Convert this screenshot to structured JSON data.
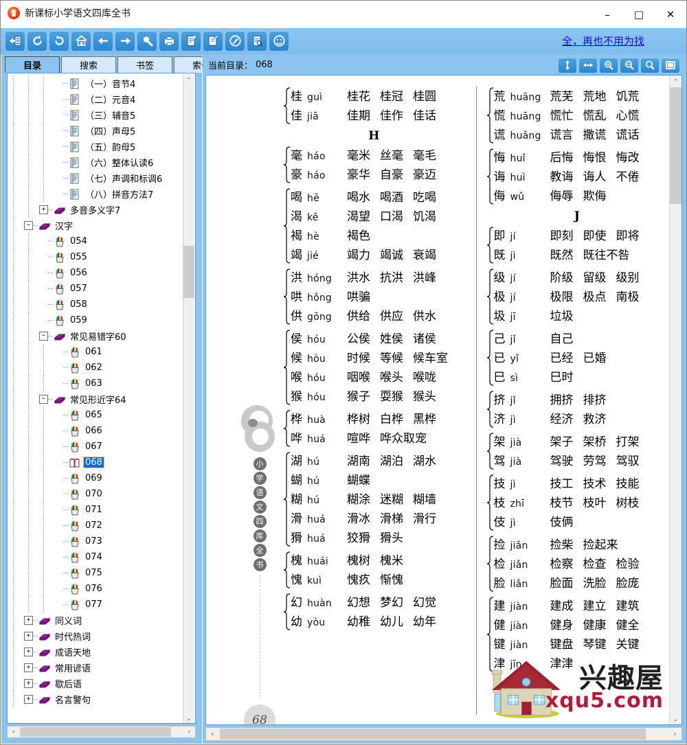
{
  "window": {
    "title": "新课标小学语文四库全书",
    "app_icon": "book-app-icon",
    "minimize": "–",
    "maximize": "□",
    "close": "✕"
  },
  "toolbar": {
    "icons": [
      {
        "name": "contents-pane-icon",
        "title": "目录"
      },
      {
        "name": "refresh-icon",
        "title": "刷新"
      },
      {
        "name": "undo-icon",
        "title": "后退"
      },
      {
        "name": "home-icon",
        "title": "主页"
      },
      {
        "name": "arrow-left-icon",
        "title": "上一页"
      },
      {
        "name": "arrow-right-icon",
        "title": "下一页"
      },
      {
        "name": "search-icon",
        "title": "查找"
      },
      {
        "name": "printer-icon",
        "title": "打印"
      },
      {
        "name": "new-note-icon",
        "title": "新建"
      },
      {
        "name": "edit-note-icon",
        "title": "编辑"
      },
      {
        "name": "pen-circle-icon",
        "title": "标注"
      },
      {
        "name": "document-search-icon",
        "title": "文档查找"
      },
      {
        "name": "smiley-icon",
        "title": "关于"
      }
    ],
    "promo_text": "全，再也不用为找"
  },
  "sidebar": {
    "tabs": [
      {
        "label": "目录",
        "active": true
      },
      {
        "label": "搜索",
        "active": false
      },
      {
        "label": "书签",
        "active": false
      },
      {
        "label": "索引",
        "active": false
      }
    ],
    "tree": [
      {
        "label": "（一）音节4",
        "icon": "page-icon",
        "depth": 4,
        "expander": "",
        "selected": false
      },
      {
        "label": "（二）元音4",
        "icon": "page-icon",
        "depth": 4,
        "expander": "",
        "selected": false
      },
      {
        "label": "（三）辅音5",
        "icon": "page-icon",
        "depth": 4,
        "expander": "",
        "selected": false
      },
      {
        "label": "（四）声母5",
        "icon": "page-icon",
        "depth": 4,
        "expander": "",
        "selected": false
      },
      {
        "label": "（五）韵母5",
        "icon": "page-icon",
        "depth": 4,
        "expander": "",
        "selected": false
      },
      {
        "label": "（六）整体认读6",
        "icon": "page-icon",
        "depth": 4,
        "expander": "",
        "selected": false
      },
      {
        "label": "（七）声调和标调6",
        "icon": "page-icon",
        "depth": 4,
        "expander": "",
        "selected": false
      },
      {
        "label": "（八）拼音方法7",
        "icon": "page-icon",
        "depth": 4,
        "expander": "",
        "selected": false
      },
      {
        "label": "多音多义字7",
        "icon": "book-icon",
        "depth": 3,
        "expander": "+",
        "selected": false
      },
      {
        "label": "汉字",
        "icon": "book-icon",
        "depth": 2,
        "expander": "−",
        "selected": false
      },
      {
        "label": "054",
        "icon": "pencilcup-icon",
        "depth": 3,
        "expander": "",
        "selected": false
      },
      {
        "label": "055",
        "icon": "pencilcup-icon",
        "depth": 3,
        "expander": "",
        "selected": false
      },
      {
        "label": "056",
        "icon": "pencilcup-icon",
        "depth": 3,
        "expander": "",
        "selected": false
      },
      {
        "label": "057",
        "icon": "pencilcup-icon",
        "depth": 3,
        "expander": "",
        "selected": false
      },
      {
        "label": "058",
        "icon": "pencilcup-icon",
        "depth": 3,
        "expander": "",
        "selected": false
      },
      {
        "label": "059",
        "icon": "pencilcup-icon",
        "depth": 3,
        "expander": "",
        "selected": false
      },
      {
        "label": "常见易错字60",
        "icon": "book-icon",
        "depth": 3,
        "expander": "−",
        "selected": false
      },
      {
        "label": "061",
        "icon": "pencilcup-icon",
        "depth": 4,
        "expander": "",
        "selected": false
      },
      {
        "label": "062",
        "icon": "pencilcup-icon",
        "depth": 4,
        "expander": "",
        "selected": false
      },
      {
        "label": "063",
        "icon": "pencilcup-icon",
        "depth": 4,
        "expander": "",
        "selected": false
      },
      {
        "label": "常见形近字64",
        "icon": "book-icon",
        "depth": 3,
        "expander": "−",
        "selected": false
      },
      {
        "label": "065",
        "icon": "pencilcup-icon",
        "depth": 4,
        "expander": "",
        "selected": false
      },
      {
        "label": "066",
        "icon": "pencilcup-icon",
        "depth": 4,
        "expander": "",
        "selected": false
      },
      {
        "label": "067",
        "icon": "pencilcup-icon",
        "depth": 4,
        "expander": "",
        "selected": false
      },
      {
        "label": "068",
        "icon": "openbook-icon",
        "depth": 4,
        "expander": "",
        "selected": true
      },
      {
        "label": "069",
        "icon": "pencilcup-icon",
        "depth": 4,
        "expander": "",
        "selected": false
      },
      {
        "label": "070",
        "icon": "pencilcup-icon",
        "depth": 4,
        "expander": "",
        "selected": false
      },
      {
        "label": "071",
        "icon": "pencilcup-icon",
        "depth": 4,
        "expander": "",
        "selected": false
      },
      {
        "label": "072",
        "icon": "pencilcup-icon",
        "depth": 4,
        "expander": "",
        "selected": false
      },
      {
        "label": "073",
        "icon": "pencilcup-icon",
        "depth": 4,
        "expander": "",
        "selected": false
      },
      {
        "label": "074",
        "icon": "pencilcup-icon",
        "depth": 4,
        "expander": "",
        "selected": false
      },
      {
        "label": "075",
        "icon": "pencilcup-icon",
        "depth": 4,
        "expander": "",
        "selected": false
      },
      {
        "label": "076",
        "icon": "pencilcup-icon",
        "depth": 4,
        "expander": "",
        "selected": false
      },
      {
        "label": "077",
        "icon": "pencilcup-icon",
        "depth": 4,
        "expander": "",
        "selected": false
      },
      {
        "label": "同义词",
        "icon": "book-icon",
        "depth": 2,
        "expander": "+",
        "selected": false
      },
      {
        "label": "时代热词",
        "icon": "book-icon",
        "depth": 2,
        "expander": "+",
        "selected": false
      },
      {
        "label": "成语天地",
        "icon": "book-icon",
        "depth": 2,
        "expander": "+",
        "selected": false
      },
      {
        "label": "常用谚语",
        "icon": "book-icon",
        "depth": 2,
        "expander": "+",
        "selected": false
      },
      {
        "label": "歇后语",
        "icon": "book-icon",
        "depth": 2,
        "expander": "+",
        "selected": false
      },
      {
        "label": "名言警句",
        "icon": "book-icon",
        "depth": 2,
        "expander": "+",
        "selected": false
      }
    ],
    "hscroll": {
      "left_arrow": "‹",
      "right_arrow": "›"
    },
    "vscroll": {
      "up_arrow": "⌃",
      "down_arrow": "⌄"
    }
  },
  "viewer": {
    "current_dir_label": "当前目录：",
    "current_dir_value": "068",
    "tools": [
      {
        "name": "fit-height-icon",
        "glyph": "↕"
      },
      {
        "name": "fit-width-icon",
        "glyph": "↔"
      },
      {
        "name": "zoom-in-icon",
        "glyph": "+"
      },
      {
        "name": "zoom-out-icon",
        "glyph": "−"
      },
      {
        "name": "zoom-reset-icon",
        "glyph": ""
      },
      {
        "name": "fullscreen-icon",
        "glyph": "▢"
      }
    ],
    "hscroll": {
      "left_arrow": "‹",
      "right_arrow": "›"
    },
    "vscroll": {
      "up_arrow": "⌃",
      "down_arrow": "⌄"
    }
  },
  "page": {
    "page_number": "68",
    "spine_chars": [
      "小",
      "学",
      "语",
      "文",
      "四",
      "库",
      "全",
      "书"
    ],
    "watermark": {
      "brand": "兴趣屋",
      "url": "xqu5.com"
    },
    "left_column": [
      {
        "type": "group",
        "rows": [
          {
            "char": "桂",
            "pinyin": "guì",
            "words": [
              "桂花",
              "桂冠",
              "桂圆"
            ]
          },
          {
            "char": "佳",
            "pinyin": "jiā",
            "words": [
              "佳期",
              "佳作",
              "佳话"
            ]
          }
        ]
      },
      {
        "type": "letter",
        "letter": "H"
      },
      {
        "type": "group",
        "rows": [
          {
            "char": "毫",
            "pinyin": "háo",
            "words": [
              "毫米",
              "丝毫",
              "毫毛"
            ]
          },
          {
            "char": "豪",
            "pinyin": "háo",
            "words": [
              "豪华",
              "自豪",
              "豪迈"
            ]
          }
        ]
      },
      {
        "type": "group",
        "rows": [
          {
            "char": "喝",
            "pinyin": "hē",
            "words": [
              "喝水",
              "喝酒",
              "吃喝"
            ]
          },
          {
            "char": "渴",
            "pinyin": "kě",
            "words": [
              "渴望",
              "口渴",
              "饥渴"
            ]
          },
          {
            "char": "褐",
            "pinyin": "hè",
            "words": [
              "褐色"
            ]
          },
          {
            "char": "竭",
            "pinyin": "jié",
            "words": [
              "竭力",
              "竭诚",
              "衰竭"
            ]
          }
        ]
      },
      {
        "type": "group",
        "rows": [
          {
            "char": "洪",
            "pinyin": "hóng",
            "words": [
              "洪水",
              "抗洪",
              "洪峰"
            ]
          },
          {
            "char": "哄",
            "pinyin": "hǒng",
            "words": [
              "哄骗"
            ]
          },
          {
            "char": "供",
            "pinyin": "gōng",
            "words": [
              "供给",
              "供应",
              "供水"
            ]
          }
        ]
      },
      {
        "type": "group",
        "rows": [
          {
            "char": "侯",
            "pinyin": "hóu",
            "words": [
              "公侯",
              "姓侯",
              "诸侯"
            ]
          },
          {
            "char": "候",
            "pinyin": "hòu",
            "words": [
              "时候",
              "等候",
              "候车室"
            ]
          },
          {
            "char": "喉",
            "pinyin": "hóu",
            "words": [
              "咽喉",
              "喉头",
              "喉咙"
            ]
          },
          {
            "char": "猴",
            "pinyin": "hóu",
            "words": [
              "猴子",
              "耍猴",
              "猴头"
            ]
          }
        ]
      },
      {
        "type": "group",
        "rows": [
          {
            "char": "桦",
            "pinyin": "huà",
            "words": [
              "桦树",
              "白桦",
              "黑桦"
            ]
          },
          {
            "char": "哗",
            "pinyin": "huá",
            "words": [
              "喧哗",
              "哗众取宠"
            ]
          }
        ]
      },
      {
        "type": "group",
        "rows": [
          {
            "char": "湖",
            "pinyin": "hú",
            "words": [
              "湖南",
              "湖泊",
              "湖水"
            ]
          },
          {
            "char": "蝴",
            "pinyin": "hú",
            "words": [
              "蝴蝶"
            ]
          },
          {
            "char": "糊",
            "pinyin": "hú",
            "words": [
              "糊涂",
              "迷糊",
              "糊墙"
            ]
          },
          {
            "char": "滑",
            "pinyin": "huá",
            "words": [
              "滑冰",
              "滑梯",
              "滑行"
            ]
          },
          {
            "char": "猾",
            "pinyin": "huá",
            "words": [
              "狡猾",
              "猾头"
            ]
          }
        ]
      },
      {
        "type": "group",
        "rows": [
          {
            "char": "槐",
            "pinyin": "huái",
            "words": [
              "槐树",
              "槐米"
            ]
          },
          {
            "char": "愧",
            "pinyin": "kuì",
            "words": [
              "愧疚",
              "惭愧"
            ]
          }
        ]
      },
      {
        "type": "group",
        "rows": [
          {
            "char": "幻",
            "pinyin": "huàn",
            "words": [
              "幻想",
              "梦幻",
              "幻觉"
            ]
          },
          {
            "char": "幼",
            "pinyin": "yòu",
            "words": [
              "幼稚",
              "幼儿",
              "幼年"
            ]
          }
        ]
      }
    ],
    "right_column": [
      {
        "type": "group",
        "rows": [
          {
            "char": "荒",
            "pinyin": "huāng",
            "words": [
              "荒芜",
              "荒地",
              "饥荒"
            ]
          },
          {
            "char": "慌",
            "pinyin": "huāng",
            "words": [
              "慌忙",
              "慌乱",
              "心慌"
            ]
          },
          {
            "char": "谎",
            "pinyin": "huǎng",
            "words": [
              "谎言",
              "撒谎",
              "谎话"
            ]
          }
        ]
      },
      {
        "type": "group",
        "rows": [
          {
            "char": "悔",
            "pinyin": "huǐ",
            "words": [
              "后悔",
              "悔恨",
              "悔改"
            ]
          },
          {
            "char": "诲",
            "pinyin": "huì",
            "words": [
              "教诲",
              "诲人",
              "不倦"
            ]
          },
          {
            "char": "侮",
            "pinyin": "wǔ",
            "words": [
              "侮辱",
              "欺侮"
            ]
          }
        ]
      },
      {
        "type": "letter",
        "letter": "J"
      },
      {
        "type": "group",
        "rows": [
          {
            "char": "即",
            "pinyin": "jí",
            "words": [
              "即刻",
              "即使",
              "即将"
            ]
          },
          {
            "char": "既",
            "pinyin": "jì",
            "words": [
              "既然",
              "既往不咎"
            ]
          }
        ]
      },
      {
        "type": "group",
        "rows": [
          {
            "char": "级",
            "pinyin": "jí",
            "words": [
              "阶级",
              "留级",
              "级别"
            ]
          },
          {
            "char": "极",
            "pinyin": "jí",
            "words": [
              "极限",
              "极点",
              "南极"
            ]
          },
          {
            "char": "圾",
            "pinyin": "jī",
            "words": [
              "垃圾"
            ]
          }
        ]
      },
      {
        "type": "group",
        "rows": [
          {
            "char": "己",
            "pinyin": "jǐ",
            "words": [
              "自己"
            ]
          },
          {
            "char": "已",
            "pinyin": "yǐ",
            "words": [
              "已经",
              "已婚"
            ]
          },
          {
            "char": "巳",
            "pinyin": "sì",
            "words": [
              "巳时"
            ]
          }
        ]
      },
      {
        "type": "group",
        "rows": [
          {
            "char": "挤",
            "pinyin": "jǐ",
            "words": [
              "拥挤",
              "排挤"
            ]
          },
          {
            "char": "济",
            "pinyin": "jì",
            "words": [
              "经济",
              "救济"
            ]
          }
        ]
      },
      {
        "type": "group",
        "rows": [
          {
            "char": "架",
            "pinyin": "jià",
            "words": [
              "架子",
              "架桥",
              "打架"
            ]
          },
          {
            "char": "驾",
            "pinyin": "jià",
            "words": [
              "驾驶",
              "劳驾",
              "驾驭"
            ]
          }
        ]
      },
      {
        "type": "group",
        "rows": [
          {
            "char": "技",
            "pinyin": "jì",
            "words": [
              "技工",
              "技术",
              "技能"
            ]
          },
          {
            "char": "枝",
            "pinyin": "zhī",
            "words": [
              "枝节",
              "枝叶",
              "树枝"
            ]
          },
          {
            "char": "伎",
            "pinyin": "jì",
            "words": [
              "伎俩"
            ]
          }
        ]
      },
      {
        "type": "group",
        "rows": [
          {
            "char": "捡",
            "pinyin": "jiǎn",
            "words": [
              "捡柴",
              "捡起来"
            ]
          },
          {
            "char": "检",
            "pinyin": "jiǎn",
            "words": [
              "检察",
              "检查",
              "检验"
            ]
          },
          {
            "char": "脸",
            "pinyin": "liǎn",
            "words": [
              "脸面",
              "洗脸",
              "脸庞"
            ]
          }
        ]
      },
      {
        "type": "group",
        "rows": [
          {
            "char": "建",
            "pinyin": "jiàn",
            "words": [
              "建成",
              "建立",
              "建筑"
            ]
          },
          {
            "char": "健",
            "pinyin": "jiàn",
            "words": [
              "健身",
              "健康",
              "健全"
            ]
          },
          {
            "char": "键",
            "pinyin": "jiàn",
            "words": [
              "键盘",
              "琴键",
              "关键"
            ]
          },
          {
            "char": "津",
            "pinyin": "jīn",
            "words": [
              "津津"
            ]
          }
        ]
      }
    ]
  },
  "colors": {
    "accent": "#8cc4f0",
    "toolbar_button": "#2a86d0",
    "selection": "#1669d6",
    "link": "#1010d0",
    "watermark_url": "#b31b3b"
  }
}
